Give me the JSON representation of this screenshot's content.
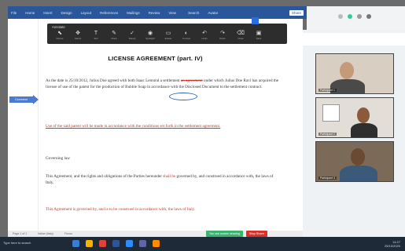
{
  "ribbon": {
    "tabs": [
      "File",
      "Home",
      "Insert",
      "Design",
      "Layout",
      "References",
      "Mailings",
      "Review",
      "View"
    ],
    "search": "Search",
    "account": "Avatar",
    "share": "Share"
  },
  "annotation_toolbar": {
    "label": "Annotate",
    "tools": [
      {
        "icon": "mouse-icon",
        "glyph": "⬉",
        "caption": "Mouse"
      },
      {
        "icon": "select-icon",
        "glyph": "✥",
        "caption": "Select"
      },
      {
        "icon": "text-icon",
        "glyph": "T",
        "caption": "Text"
      },
      {
        "icon": "draw-icon",
        "glyph": "✎",
        "caption": "Draw"
      },
      {
        "icon": "stamp-icon",
        "glyph": "✓",
        "caption": "Stamp"
      },
      {
        "icon": "spotlight-icon",
        "glyph": "◉",
        "caption": "Spotlight"
      },
      {
        "icon": "eraser-icon",
        "glyph": "▭",
        "caption": "Eraser"
      },
      {
        "icon": "format-icon",
        "glyph": "◐",
        "caption": "Format"
      },
      {
        "icon": "undo-icon",
        "glyph": "↶",
        "caption": "Undo"
      },
      {
        "icon": "redo-icon",
        "glyph": "↷",
        "caption": "Redo"
      },
      {
        "icon": "clear-icon",
        "glyph": "⌫",
        "caption": "Clear"
      },
      {
        "icon": "save-icon",
        "glyph": "▣",
        "caption": "Save"
      }
    ]
  },
  "document": {
    "title": "LICENSE AGREEMENT (part. IV)",
    "comment_tag": "Comment",
    "p1_a": "As the date is 25/10/2012, Julius Doe agreed with both Isaac Lemond a settlement ",
    "p1_del": "an agreement",
    "p1_b": " under which Julius Doe Ravi has acquired the license of use of the patent for the production of Bubble Soap in accordance with the Disclosed Document to the settlement contract.",
    "p2": "Use of the said patent will be made in accordance with the conditions set forth in the settlement agreement.",
    "p3": "Governing law",
    "p4_a": "This Agreement, and the rights and obligations of the Parties hereunder ",
    "p4_del": "shall be",
    "p4_b": " governed by, and construed in accordance with, the laws of Italy.",
    "p5": "This Agreement is governed by, and is to be construed in accordance with, the laws of Italy."
  },
  "status_bar": {
    "page": "Page 1 of 1",
    "words": "Italian (Italy)",
    "focus": "Focus"
  },
  "meeting": {
    "share_label": "You are screen sharing",
    "stop_label": "Stop Share",
    "participants": [
      {
        "name": "Participant 1"
      },
      {
        "name": "Participant 2"
      },
      {
        "name": "Participant 3"
      }
    ]
  },
  "taskbar": {
    "start": "Type here to search",
    "time": "14:27",
    "date": "25/10/2020"
  },
  "colors": {
    "word_blue": "#2b579a",
    "track_red": "#c0392b",
    "taskbar": "#1f2a38"
  }
}
